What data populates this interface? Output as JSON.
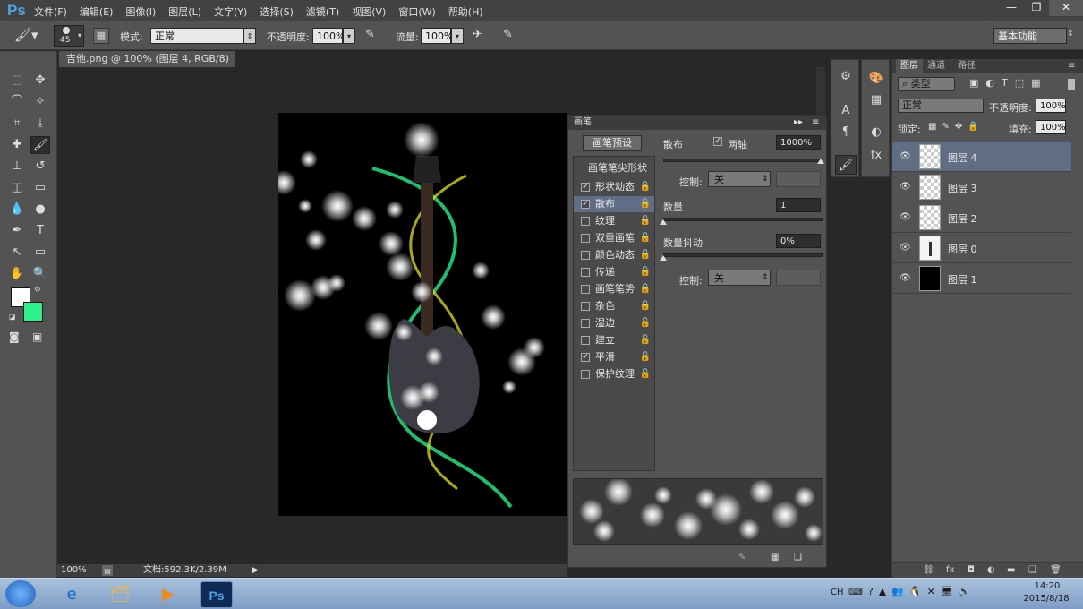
{
  "app": {
    "logo": "Ps"
  },
  "menu": [
    "文件(F)",
    "编辑(E)",
    "图像(I)",
    "图层(L)",
    "文字(Y)",
    "选择(S)",
    "滤镜(T)",
    "视图(V)",
    "窗口(W)",
    "帮助(H)"
  ],
  "window_controls": {
    "minimize": "—",
    "restore": "❐",
    "close": "✕"
  },
  "options": {
    "brush_size": "45",
    "mode_label": "模式:",
    "mode_value": "正常",
    "opacity_label": "不透明度:",
    "opacity_value": "100%",
    "flow_label": "流量:",
    "flow_value": "100%",
    "workspace": "基本功能"
  },
  "document": {
    "tab_title": "吉他.png @ 100% (图层 4, RGB/8) *",
    "tab_close": "×",
    "zoom": "100%",
    "doc_info": "文档:592.3K/2.39M"
  },
  "colors": {
    "foreground": "#ffffff",
    "background": "#2ef08a",
    "accent_selected": "#5f6e85"
  },
  "brush_panel": {
    "title": "画笔",
    "preset_button": "画笔预设",
    "tip_shape_header": "画笔笔尖形状",
    "options": [
      {
        "label": "形状动态",
        "checked": true,
        "check": "✓"
      },
      {
        "label": "散布",
        "checked": true,
        "check": "✓",
        "selected": true
      },
      {
        "label": "纹理",
        "checked": false,
        "check": ""
      },
      {
        "label": "双重画笔",
        "checked": false,
        "check": ""
      },
      {
        "label": "颜色动态",
        "checked": false,
        "check": ""
      },
      {
        "label": "传递",
        "checked": false,
        "check": ""
      },
      {
        "label": "画笔笔势",
        "checked": false,
        "check": ""
      },
      {
        "label": "杂色",
        "checked": false,
        "check": ""
      },
      {
        "label": "湿边",
        "checked": false,
        "check": ""
      },
      {
        "label": "建立",
        "checked": false,
        "check": ""
      },
      {
        "label": "平滑",
        "checked": true,
        "check": "✓"
      },
      {
        "label": "保护纹理",
        "checked": false,
        "check": ""
      }
    ],
    "scatter_label": "散布",
    "both_axes_check": "✓",
    "both_axes_label": "两轴",
    "scatter_value": "1000%",
    "control_label": "控制:",
    "control_value": "关",
    "count_label": "数量",
    "count_value": "1",
    "count_jitter_label": "数量抖动",
    "count_jitter_value": "0%",
    "control2_label": "控制:",
    "control2_value": "关"
  },
  "layers_panel": {
    "tabs": [
      "图层",
      "通道",
      "路径"
    ],
    "filter_kind": "类型",
    "blend_mode": "正常",
    "opacity_label": "不透明度:",
    "opacity_value": "100%",
    "lock_label": "锁定:",
    "fill_label": "填充:",
    "fill_value": "100%",
    "layers": [
      {
        "name": "图层 4",
        "selected": true,
        "thumb": "transparent"
      },
      {
        "name": "图层 3",
        "selected": false,
        "thumb": "transparent"
      },
      {
        "name": "图层 2",
        "selected": false,
        "thumb": "transparent"
      },
      {
        "name": "图层 0",
        "selected": false,
        "thumb": "guitar"
      },
      {
        "name": "图层 1",
        "selected": false,
        "thumb": "black"
      }
    ]
  },
  "taskbar": {
    "lang": "CH",
    "time": "14:20",
    "date": "2015/8/18"
  }
}
